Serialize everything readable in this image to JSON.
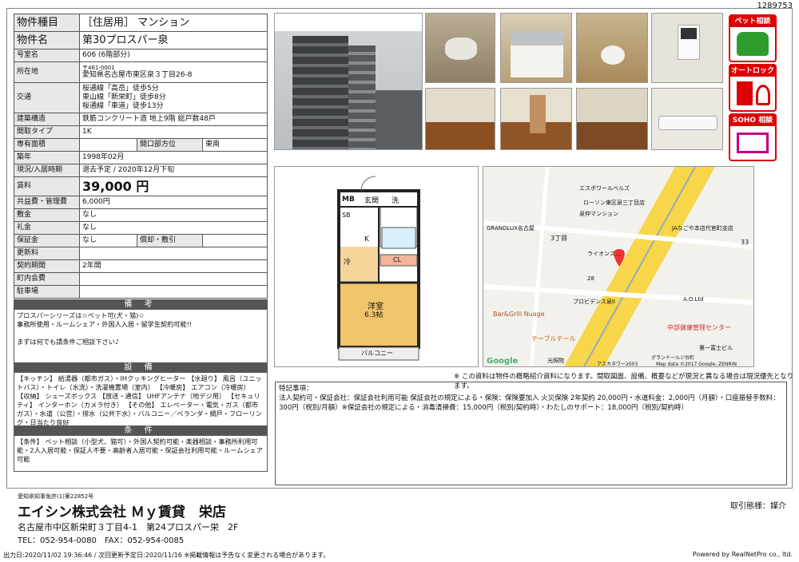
{
  "doc_no": "1289753",
  "rows": [
    {
      "k": "物件種目",
      "v": "［住居用］ マンション"
    },
    {
      "k": "物件名",
      "v": "第30プロスパー泉"
    },
    {
      "k": "号室名",
      "v": "606 (6階部分)"
    },
    {
      "k": "所在地",
      "v_small": "〒461-0001",
      "v": "愛知県名古屋市東区泉３丁目26-8"
    },
    {
      "k": "交通",
      "lines": [
        "桜通線「高岳」徒歩5分",
        "東山線「新栄町」徒歩8分",
        "桜通線「車道」徒歩13分"
      ]
    },
    {
      "k": "建築構造",
      "v": "鉄筋コンクリート造 地上9階 総戸数48戸"
    },
    {
      "k": "間取タイプ",
      "v": "1K"
    },
    {
      "k": "専有面積",
      "v": "",
      "k2": "開口部方位",
      "v2": "東南"
    },
    {
      "k": "築年",
      "v": "1998年02月"
    },
    {
      "k": "現況/入居時期",
      "v": "退去予定 / 2020年12月下旬"
    },
    {
      "k": "賃料",
      "v": "39,000 円"
    },
    {
      "k": "共益費・管理費",
      "v": "6,000円"
    },
    {
      "k": "敷金",
      "v": "なし"
    },
    {
      "k": "礼金",
      "v": "なし"
    },
    {
      "k": "保証金",
      "v": "なし",
      "k2": "償却・敷引",
      "v2": ""
    },
    {
      "k": "更新料",
      "v": ""
    },
    {
      "k": "契約期間",
      "v": "2年間"
    },
    {
      "k": "町内会費",
      "v": ""
    },
    {
      "k": "駐車場",
      "v": ""
    }
  ],
  "biko": {
    "title": "備 考",
    "text": "プロスパーシリーズは☆ペット可(犬・猫)☆\n事務所使用・ルームシェア・外国人入居・留学生契約可能!!\n\nまずは何でも請条件ご相談下さい♪"
  },
  "setsubi": {
    "title": "設 備",
    "text": "【キッチン】 給湯器（都市ガス）・IHクッキングヒーター 【水廻り】 風呂（ユニットバス）・トイレ（水洗）・洗濯機置場（室内） 【冷暖房】 エアコン（冷暖房） 【収納】 シューズボックス 【放送・通信】 UHFアンテナ（地デジ用） 【セキュリティ】 インターホン（カメラ付き） 【その他】 エレベーター・電気・ガス（都市ガス）・水道（公営）・排水（公共下水）・バルコニー／ベランダ・網戸・フローリング・日当たり良好"
  },
  "joken": {
    "title": "条 件",
    "text": "【条件】 ペット相談（小型犬、猫可）・外国人契約可能・楽器相談・事務所利用可能・2人入居可能・保証人不要・高齢者入居可能・保証会社利用可能・ルームシェア可能"
  },
  "icons": [
    {
      "label": "ペット相談",
      "name": "pet-icon"
    },
    {
      "label": "オートロック",
      "name": "autolock-icon"
    },
    {
      "label": "SOHO 相談",
      "name": "soho-icon"
    }
  ],
  "plan": {
    "mb": "MB",
    "genkan": "玄関",
    "sen": "洗",
    "sb": "SB",
    "k": "K",
    "rei": "冷",
    "cl": "CL",
    "room": "洋室",
    "size": "6.3帖",
    "balcony": "バルコニー"
  },
  "map": {
    "labels": [
      "エスポワールベルズ",
      "ローソン東区泉三丁目店",
      "泉仲マンション",
      "GRANDLUX名古屋",
      "3丁目",
      "JAなごや本店代官町支店",
      "ライオンズ…",
      "28",
      "プロビデンス泉II",
      "A.O.Ltd",
      "Bar&Grill Nuage",
      "中部健康管理センター",
      "テーブルテール",
      "第一富士ビル",
      "光照院",
      "アスカタワー2003",
      "グランドールジ台町",
      "33"
    ],
    "google": "Google",
    "credit": "Map data ©2017 Google, ZENRIN"
  },
  "caution": "※ この資料は物件の概略紹介資料になります。間取図面、設備、概要などが現況と異なる場合は現況優先となります。",
  "tokki": {
    "title": "特記事項：",
    "text": "法人契約可・保証会社：保証会社利用可能 保証会社の規定による・保険：保険要加入 火災保険 2年契約 20,000円・水道料金：2,000円（月額）・口座振替手数料：300円（税別/月額）※保証会社の規定による・消毒清掃費：15,000円（税別/契約時）・わたしのサポート：18,000円（税別/契約時）"
  },
  "footer": {
    "license": "愛知県知事免許(1)第22852号",
    "company": "エイシン株式会社 Ｍｙ賃貸　栄店",
    "address": "名古屋市中区新栄町３丁目4-1　第24プロスパー栄　2F",
    "tel": "TEL：052-954-0080　FAX：052-954-0085",
    "torihiki": "取引態様：媒介"
  },
  "bottom": {
    "left": "出力日:2020/11/02 19:36:46 / 次回更新予定日:2020/11/16 ※掲載情報は予告なく変更される場合があります。",
    "right": "Powered by RealNetPro co., ltd."
  }
}
